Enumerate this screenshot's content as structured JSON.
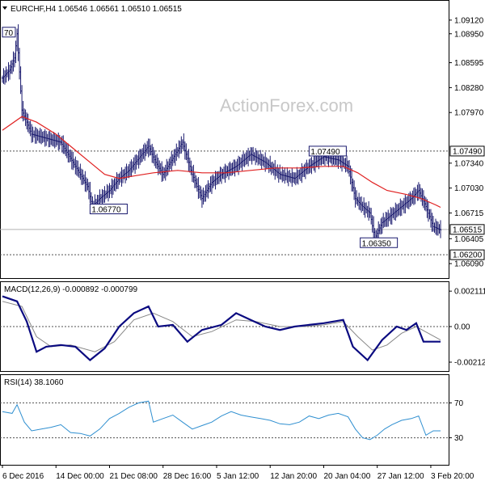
{
  "header": {
    "symbol_line": "EURCHF,H4 1.06546 1.06561 1.06510 1.06515",
    "dropdown_icon": "triangle-down-icon"
  },
  "watermark": "ActionForex.com",
  "colors": {
    "price_bars": "#1a1a6e",
    "moving_average": "#e02020",
    "macd_line": "#0a0a80",
    "macd_signal": "#888888",
    "rsi_line": "#2f8fd0",
    "dotted_levels": "#505050"
  },
  "chart_data": [
    {
      "type": "ohlc",
      "panel": "price",
      "ylim": [
        1.0592,
        1.0935
      ],
      "y_ticks": [
        {
          "value": 1.0912,
          "label": "1.09120"
        },
        {
          "value": 1.0895,
          "label": "1.08950"
        },
        {
          "value": 1.0859,
          "label": "1.08595"
        },
        {
          "value": 1.0828,
          "label": "1.08280"
        },
        {
          "value": 1.0797,
          "label": "1.07970"
        },
        {
          "value": 1.0734,
          "label": "1.07340"
        },
        {
          "value": 1.0703,
          "label": "1.07030"
        },
        {
          "value": 1.0672,
          "label": "1.06715"
        },
        {
          "value": 1.064,
          "label": "1.06405"
        },
        {
          "value": 1.0609,
          "label": "1.06090"
        }
      ],
      "level_lines": [
        {
          "value": 1.0749,
          "label": "1.07490",
          "style": "dotted"
        },
        {
          "value": 1.062,
          "label": "1.06200",
          "style": "dotted"
        }
      ],
      "current_price": {
        "value": 1.06515,
        "label": "1.06515"
      },
      "annotations": [
        {
          "label": "70",
          "x": 0,
          "value": 1.0897
        },
        {
          "label": "1.07490",
          "x": 126,
          "value": 1.0749
        },
        {
          "label": "1.06770",
          "x": 36,
          "value": 1.0677
        },
        {
          "label": "1.06350",
          "x": 147,
          "value": 1.0635
        }
      ],
      "close_path": [
        [
          0,
          1.084
        ],
        [
          3,
          1.085
        ],
        [
          5,
          1.0865
        ],
        [
          6,
          1.0895
        ],
        [
          8,
          1.08
        ],
        [
          12,
          1.077
        ],
        [
          18,
          1.0765
        ],
        [
          24,
          1.076
        ],
        [
          30,
          1.073
        ],
        [
          35,
          1.0705
        ],
        [
          37,
          1.068
        ],
        [
          40,
          1.069
        ],
        [
          44,
          1.07
        ],
        [
          48,
          1.0715
        ],
        [
          52,
          1.0725
        ],
        [
          56,
          1.074
        ],
        [
          60,
          1.0755
        ],
        [
          63,
          1.0735
        ],
        [
          66,
          1.072
        ],
        [
          70,
          1.074
        ],
        [
          74,
          1.076
        ],
        [
          78,
          1.072
        ],
        [
          82,
          1.069
        ],
        [
          86,
          1.071
        ],
        [
          90,
          1.072
        ],
        [
          96,
          1.073
        ],
        [
          102,
          1.0745
        ],
        [
          108,
          1.0735
        ],
        [
          114,
          1.072
        ],
        [
          120,
          1.0715
        ],
        [
          126,
          1.073
        ],
        [
          132,
          1.0742
        ],
        [
          138,
          1.0738
        ],
        [
          142,
          1.073
        ],
        [
          145,
          1.069
        ],
        [
          148,
          1.068
        ],
        [
          151,
          1.0672
        ],
        [
          153,
          1.064
        ],
        [
          156,
          1.066
        ],
        [
          160,
          1.067
        ],
        [
          164,
          1.068
        ],
        [
          168,
          1.069
        ],
        [
          171,
          1.07
        ],
        [
          174,
          1.068
        ],
        [
          177,
          1.0655
        ],
        [
          180,
          1.0651
        ]
      ],
      "ma_path": [
        [
          0,
          1.0775
        ],
        [
          8,
          1.0792
        ],
        [
          14,
          1.0785
        ],
        [
          22,
          1.077
        ],
        [
          30,
          1.075
        ],
        [
          36,
          1.0735
        ],
        [
          42,
          1.072
        ],
        [
          48,
          1.0715
        ],
        [
          54,
          1.0718
        ],
        [
          62,
          1.0722
        ],
        [
          72,
          1.0725
        ],
        [
          82,
          1.0722
        ],
        [
          92,
          1.0722
        ],
        [
          102,
          1.0725
        ],
        [
          112,
          1.0728
        ],
        [
          122,
          1.0728
        ],
        [
          132,
          1.073
        ],
        [
          140,
          1.073
        ],
        [
          146,
          1.0722
        ],
        [
          152,
          1.071
        ],
        [
          158,
          1.07
        ],
        [
          166,
          1.0695
        ],
        [
          172,
          1.069
        ],
        [
          178,
          1.0682
        ],
        [
          180,
          1.0679
        ]
      ],
      "x_axis": {
        "type": "time",
        "tick_labels": [
          "6 Dec 2016",
          "14 Dec 00:00",
          "21 Dec 08:00",
          "28 Dec 16:00",
          "5 Jan 12:00",
          "12 Jan 20:00",
          "20 Jan 04:00",
          "27 Jan 12:00",
          "3 Feb 20:00"
        ],
        "tick_positions": [
          0,
          22,
          44,
          66,
          88,
          110,
          132,
          154,
          176
        ],
        "bars_range": [
          0,
          180
        ]
      }
    },
    {
      "type": "line",
      "panel": "macd",
      "title": "MACD(12,26,9) -0.000892 -0.000799",
      "ylim": [
        -0.0026,
        0.0026
      ],
      "y_ticks": [
        {
          "value": 0.002111,
          "label": "0.002111"
        },
        {
          "value": 0.0,
          "label": "0.00"
        },
        {
          "value": -0.00212,
          "label": "-0.00212"
        }
      ],
      "series": [
        {
          "role": "macd",
          "values": [
            [
              0,
              0.0018
            ],
            [
              6,
              0.0015
            ],
            [
              10,
              0.0003
            ],
            [
              14,
              -0.0015
            ],
            [
              18,
              -0.0012
            ],
            [
              24,
              -0.0011
            ],
            [
              30,
              -0.0012
            ],
            [
              36,
              -0.002
            ],
            [
              42,
              -0.0013
            ],
            [
              48,
              0.0
            ],
            [
              54,
              0.0008
            ],
            [
              60,
              0.0012
            ],
            [
              64,
              0.0
            ],
            [
              70,
              0.0001
            ],
            [
              76,
              -0.0009
            ],
            [
              82,
              -0.0002
            ],
            [
              90,
              0.0001
            ],
            [
              96,
              0.0008
            ],
            [
              102,
              0.0004
            ],
            [
              108,
              0.0
            ],
            [
              114,
              -0.0002
            ],
            [
              120,
              0.0
            ],
            [
              126,
              0.0001
            ],
            [
              132,
              0.0002
            ],
            [
              140,
              0.0004
            ],
            [
              144,
              -0.0012
            ],
            [
              150,
              -0.002
            ],
            [
              156,
              -0.0008
            ],
            [
              162,
              0.0
            ],
            [
              166,
              -0.0002
            ],
            [
              170,
              0.0002
            ],
            [
              173,
              -0.0009
            ],
            [
              180,
              -0.0009
            ]
          ]
        },
        {
          "role": "signal",
          "values": [
            [
              0,
              0.0015
            ],
            [
              8,
              0.0012
            ],
            [
              14,
              -0.0006
            ],
            [
              20,
              -0.0012
            ],
            [
              28,
              -0.0011
            ],
            [
              38,
              -0.0015
            ],
            [
              46,
              -0.0009
            ],
            [
              54,
              0.0004
            ],
            [
              62,
              0.0008
            ],
            [
              70,
              0.0003
            ],
            [
              78,
              -0.0006
            ],
            [
              86,
              -0.0003
            ],
            [
              96,
              0.0004
            ],
            [
              104,
              0.0003
            ],
            [
              114,
              0.0
            ],
            [
              124,
              0.0
            ],
            [
              132,
              0.0001
            ],
            [
              140,
              0.0003
            ],
            [
              146,
              -0.0006
            ],
            [
              152,
              -0.0014
            ],
            [
              158,
              -0.0011
            ],
            [
              164,
              -0.0004
            ],
            [
              170,
              0.0
            ],
            [
              175,
              -0.0004
            ],
            [
              180,
              -0.0008
            ]
          ]
        }
      ]
    },
    {
      "type": "line",
      "panel": "rsi",
      "title": "RSI(14) 38.1060",
      "ylim": [
        0,
        100
      ],
      "y_ticks": [
        {
          "value": 70,
          "label": "70"
        },
        {
          "value": 30,
          "label": "30"
        }
      ],
      "values": [
        [
          0,
          60
        ],
        [
          4,
          58
        ],
        [
          6,
          68
        ],
        [
          9,
          48
        ],
        [
          12,
          38
        ],
        [
          16,
          40
        ],
        [
          20,
          42
        ],
        [
          24,
          45
        ],
        [
          28,
          36
        ],
        [
          32,
          35
        ],
        [
          36,
          32
        ],
        [
          40,
          40
        ],
        [
          44,
          52
        ],
        [
          48,
          58
        ],
        [
          52,
          65
        ],
        [
          56,
          70
        ],
        [
          60,
          72
        ],
        [
          62,
          48
        ],
        [
          66,
          52
        ],
        [
          70,
          56
        ],
        [
          74,
          48
        ],
        [
          78,
          40
        ],
        [
          82,
          44
        ],
        [
          86,
          48
        ],
        [
          90,
          55
        ],
        [
          94,
          60
        ],
        [
          98,
          56
        ],
        [
          102,
          54
        ],
        [
          106,
          52
        ],
        [
          110,
          50
        ],
        [
          114,
          46
        ],
        [
          118,
          45
        ],
        [
          122,
          48
        ],
        [
          126,
          55
        ],
        [
          130,
          52
        ],
        [
          134,
          56
        ],
        [
          138,
          58
        ],
        [
          142,
          54
        ],
        [
          145,
          40
        ],
        [
          148,
          30
        ],
        [
          151,
          28
        ],
        [
          154,
          33
        ],
        [
          157,
          40
        ],
        [
          160,
          45
        ],
        [
          164,
          50
        ],
        [
          168,
          52
        ],
        [
          171,
          55
        ],
        [
          174,
          33
        ],
        [
          177,
          38
        ],
        [
          180,
          38
        ]
      ]
    }
  ]
}
